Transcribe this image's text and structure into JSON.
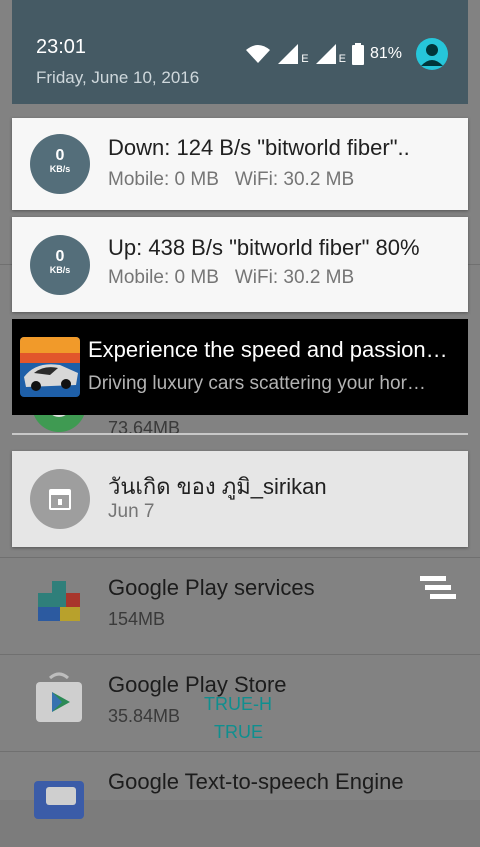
{
  "status_bar": {
    "time": "23:01",
    "date": "Friday, June 10, 2016",
    "network_label_1": "E",
    "network_label_2": "E",
    "battery_percent": "81%"
  },
  "notifications": [
    {
      "title": "Down: 124 B/s   \"bitworld fiber\"..",
      "badge_value": "0",
      "badge_unit": "KB/s",
      "mobile": "Mobile: 0 MB",
      "wifi": "WiFi: 30.2 MB"
    },
    {
      "title": "Up: 438 B/s   \"bitworld fiber\" 80%",
      "badge_value": "0",
      "badge_unit": "KB/s",
      "mobile": "Mobile: 0 MB",
      "wifi": "WiFi: 30.2 MB"
    },
    {
      "title": "Experience the speed and passion…",
      "subtitle": "Driving luxury cars scattering your hor…"
    },
    {
      "title": "วันเกิด ของ ภูมิ_sirikan",
      "subtitle": "Jun 7"
    }
  ],
  "background_apps": [
    {
      "name": "",
      "size": "73.64MB"
    },
    {
      "name": "Google Play services",
      "size": "154MB"
    },
    {
      "name": "Google Play Store",
      "size": "35.84MB"
    },
    {
      "name": "Google Text-to-speech Engine",
      "size": ""
    }
  ],
  "debug_overlay": {
    "line1": "TRUE-H",
    "line2": "TRUE"
  },
  "colors": {
    "shade_header": "#455a64",
    "avatar": "#26c6da",
    "speed_badge": "#546e7a"
  }
}
